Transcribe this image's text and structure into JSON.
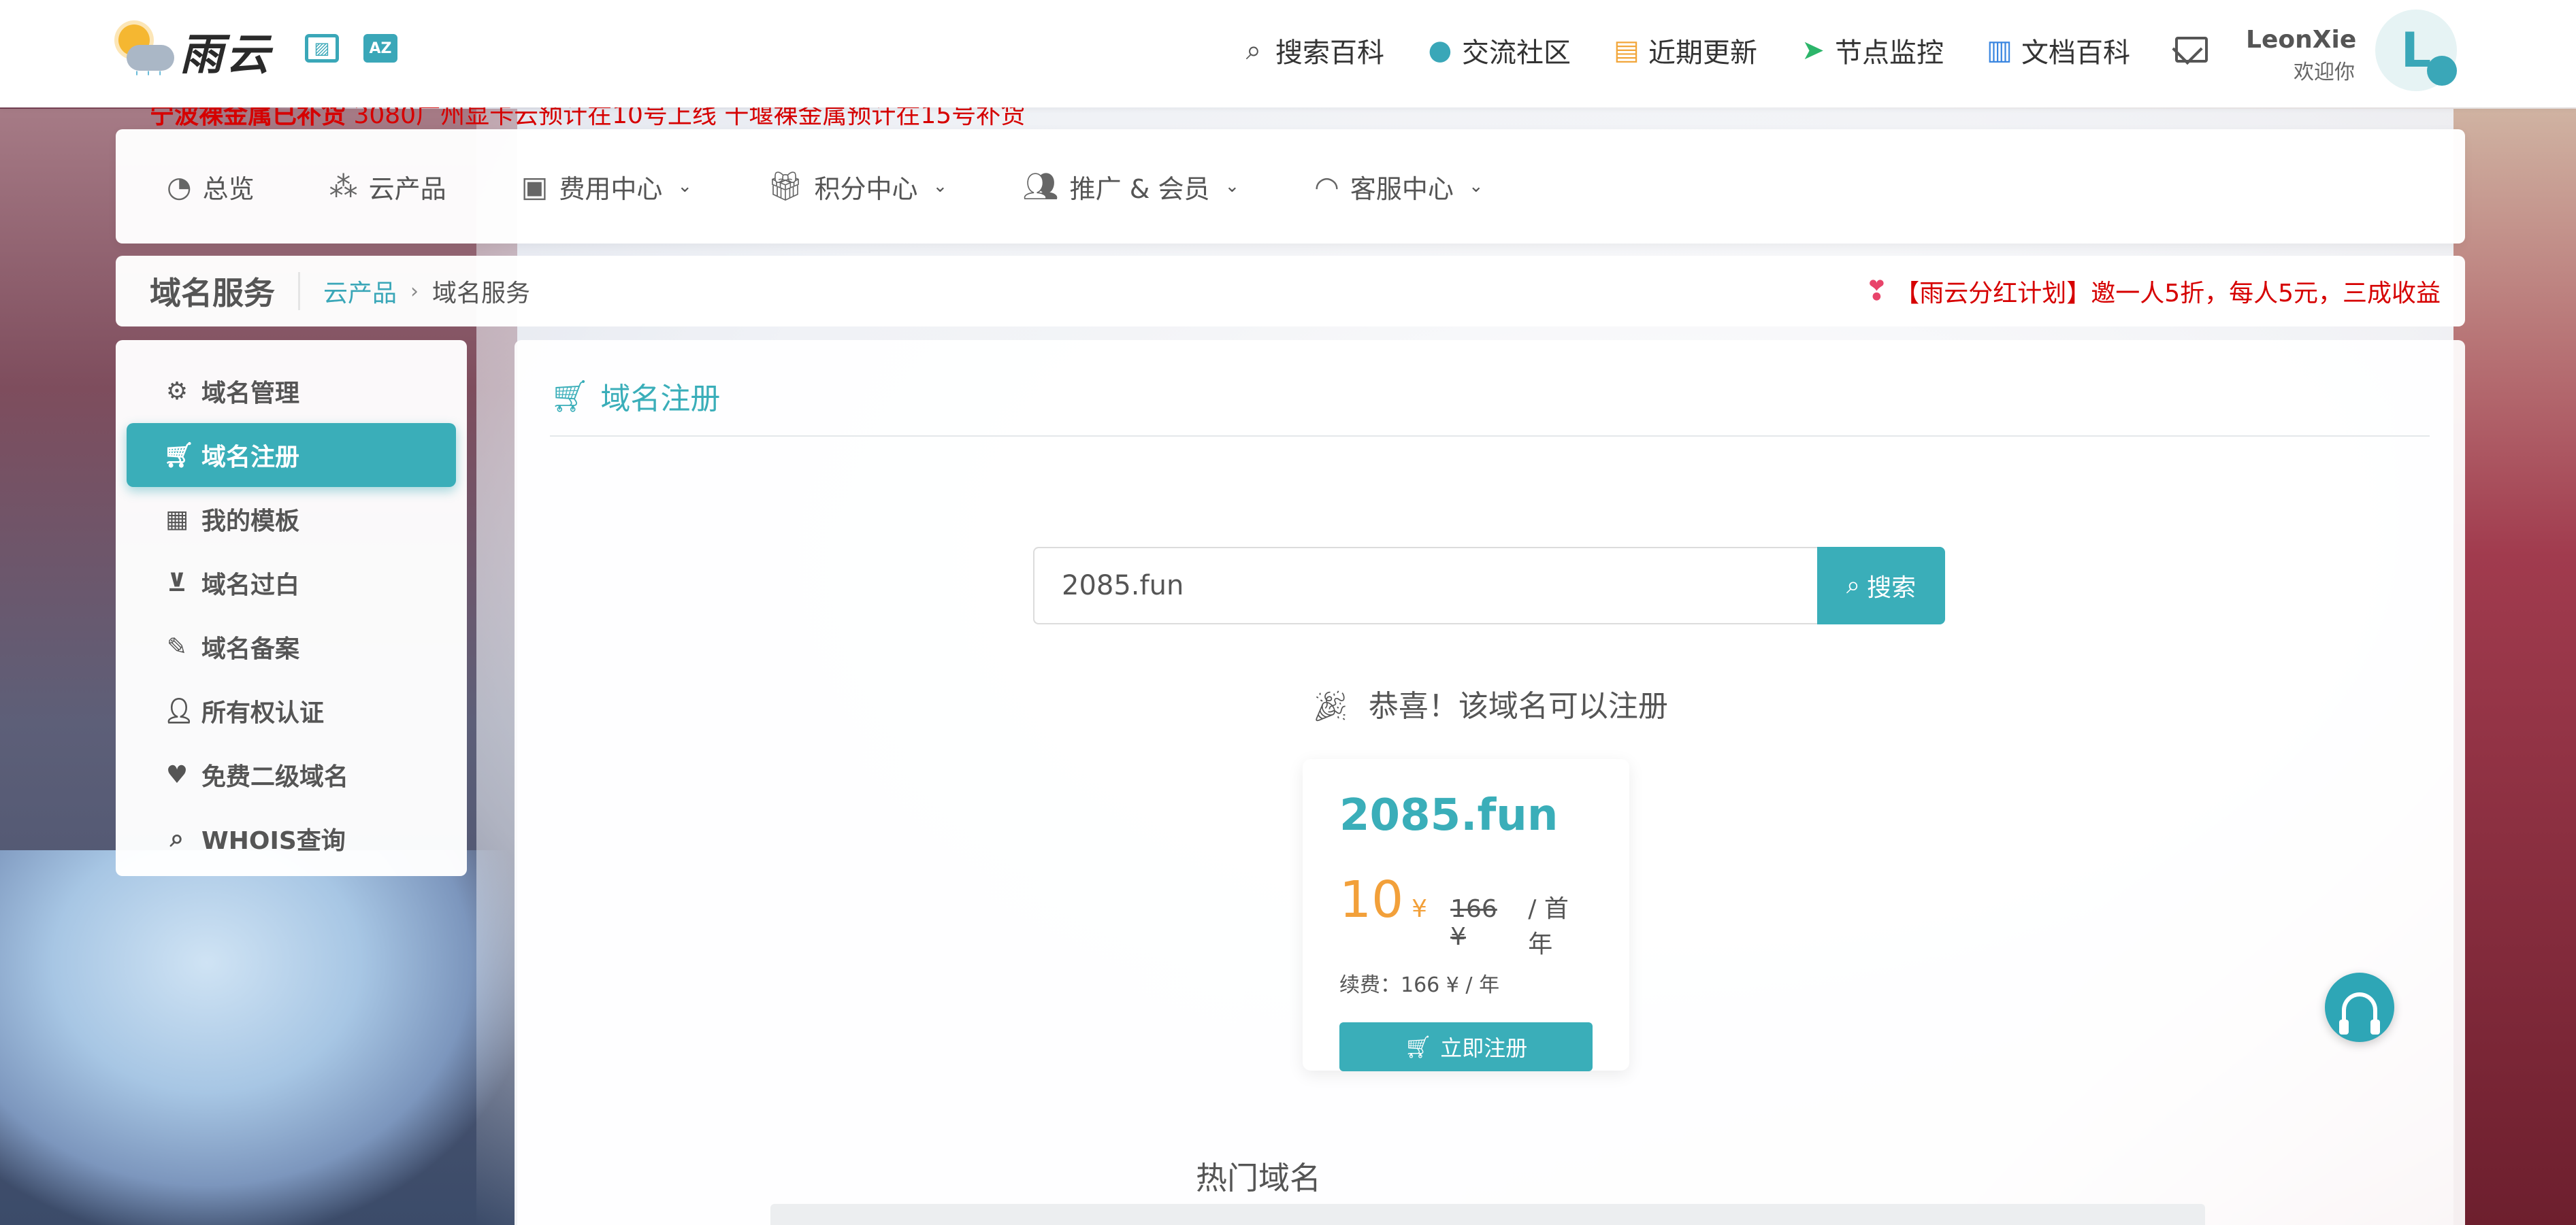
{
  "brand": {
    "logo_text": "雨云"
  },
  "top_nav": {
    "items": [
      {
        "label": "搜索百科",
        "icon": "search-icon"
      },
      {
        "label": "交流社区",
        "icon": "qq-penguin-icon"
      },
      {
        "label": "近期更新",
        "icon": "newspaper-icon"
      },
      {
        "label": "节点监控",
        "icon": "location-arrow-icon"
      },
      {
        "label": "文档百科",
        "icon": "book-open-icon"
      }
    ]
  },
  "user": {
    "name": "LeonXie",
    "welcome": "欢迎你",
    "avatar_letter": "L"
  },
  "notice": {
    "strong": "宁波裸金属已补货",
    "rest": " 3080广州显卡云预计在10号上线 十堰裸金属预计在15号补货"
  },
  "main_nav": {
    "items": [
      {
        "label": "总览",
        "icon": "dashboard-icon",
        "dropdown": false
      },
      {
        "label": "云产品",
        "icon": "cubes-icon",
        "dropdown": false
      },
      {
        "label": "费用中心",
        "icon": "money-bill-icon",
        "dropdown": true
      },
      {
        "label": "积分中心",
        "icon": "gift-icon",
        "dropdown": true
      },
      {
        "label": "推广 & 会员",
        "icon": "users-icon",
        "dropdown": true
      },
      {
        "label": "客服中心",
        "icon": "headset-icon",
        "dropdown": true
      }
    ]
  },
  "breadcrumb": {
    "title": "域名服务",
    "parent": "云产品",
    "current": "域名服务",
    "promo": "【雨云分红计划】邀一人5折，每人5元，三成收益"
  },
  "sidebar": {
    "items": [
      {
        "label": "域名管理",
        "icon": "cogs-icon"
      },
      {
        "label": "域名注册",
        "icon": "cart-plus-icon",
        "active": true
      },
      {
        "label": "我的模板",
        "icon": "id-card-icon"
      },
      {
        "label": "域名过白",
        "icon": "inbox-check-icon"
      },
      {
        "label": "域名备案",
        "icon": "file-signature-icon"
      },
      {
        "label": "所有权认证",
        "icon": "user-check-icon"
      },
      {
        "label": "免费二级域名",
        "icon": "heart-icon"
      },
      {
        "label": "WHOIS查询",
        "icon": "search-icon"
      }
    ]
  },
  "content": {
    "heading": "域名注册",
    "search": {
      "value": "2085.fun",
      "button_label": "搜索"
    },
    "result_message": "恭喜！该域名可以注册",
    "domain": {
      "name": "2085.fun",
      "price": "10",
      "currency": "¥",
      "original_price": "166 ¥",
      "period_unit": "/ 首年",
      "renewal": "续费：166 ¥ / 年",
      "register_label": "立即注册"
    },
    "hot_title": "热门域名"
  },
  "colors": {
    "accent": "#3aaeb9",
    "notice_red": "#d60000",
    "price_orange": "#f2a03a"
  }
}
